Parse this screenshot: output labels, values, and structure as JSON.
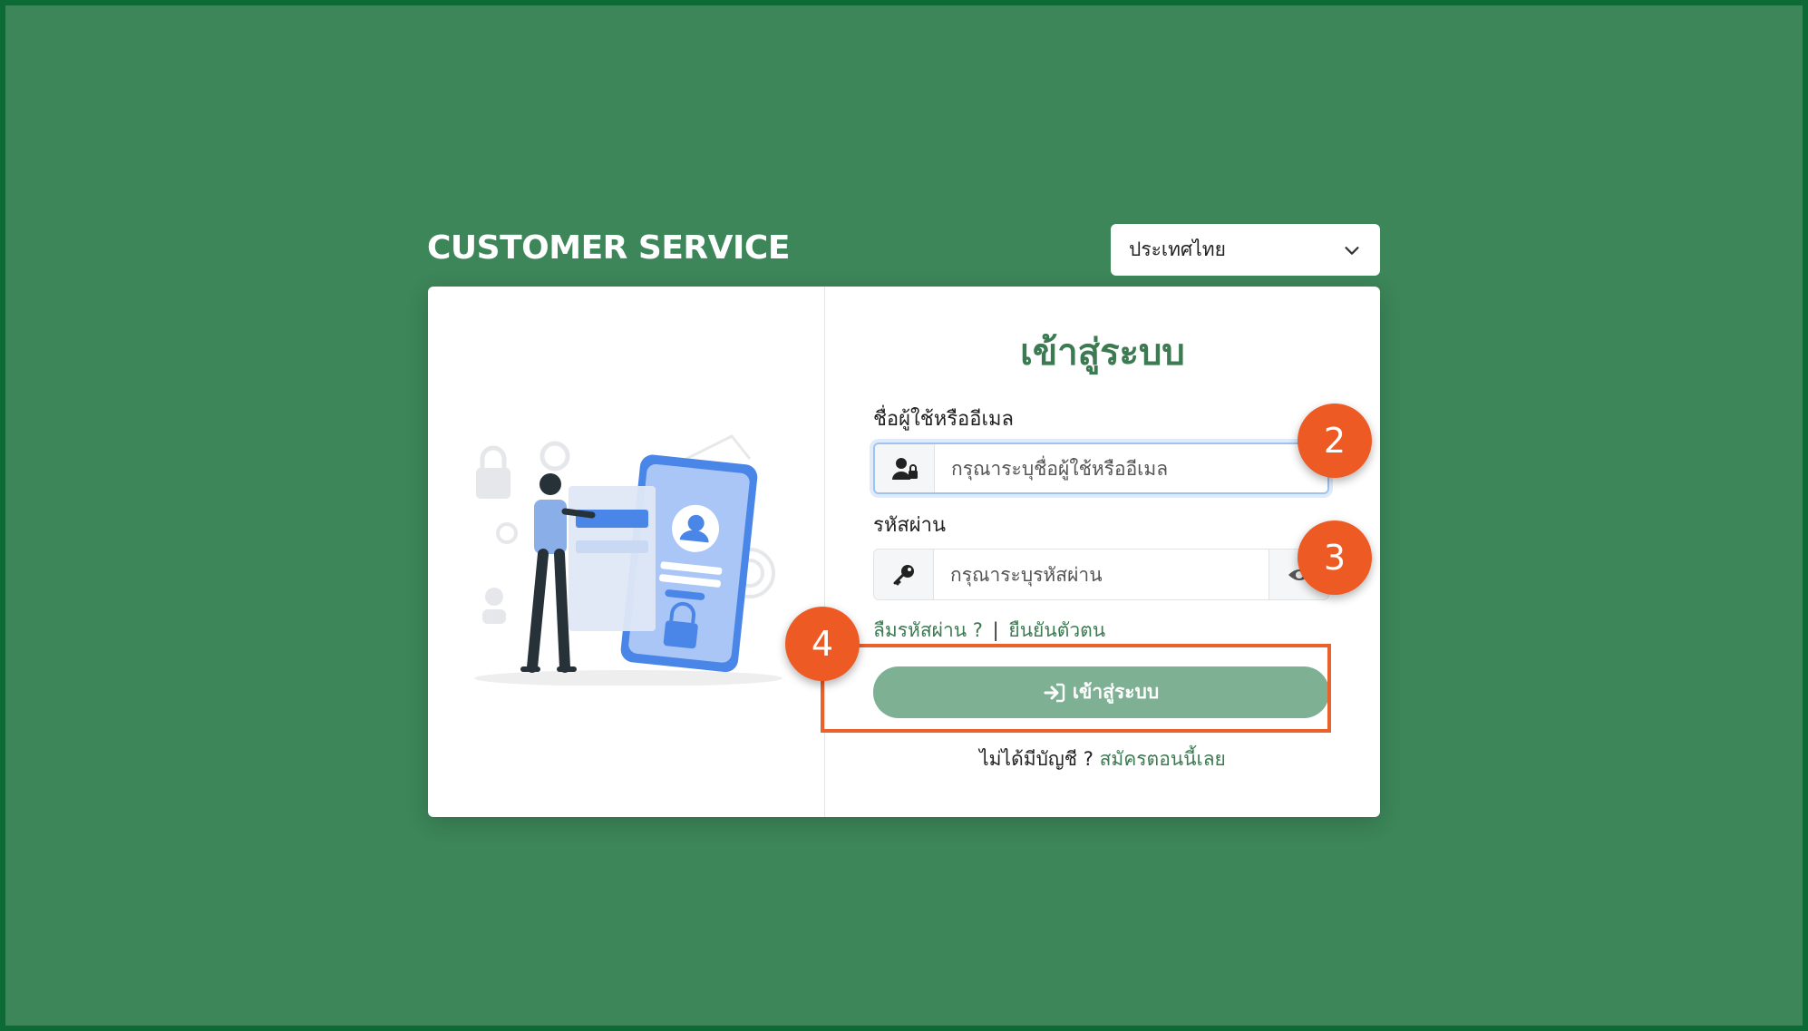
{
  "header": {
    "brand": "CUSTOMER SERVICE",
    "country_select": {
      "selected": "ประเทศไทย",
      "icon": "chevron-down-icon"
    }
  },
  "login": {
    "title": "เข้าสู่ระบบ",
    "username": {
      "label": "ชื่อผู้ใช้หรืออีเมล",
      "placeholder": "กรุณาระบุชื่อผู้ใช้หรืออีเมล",
      "value": "",
      "icon": "user-lock-icon"
    },
    "password": {
      "label": "รหัสผ่าน",
      "placeholder": "กรุณาระบุรหัสผ่าน",
      "value": "",
      "icon": "key-icon",
      "toggle_icon": "eye-icon"
    },
    "forgot_password": "ลืมรหัสผ่าน ?",
    "separator": "|",
    "verify_identity": "ยืนยันตัวตน",
    "submit_label": "เข้าสู่ระบบ",
    "submit_icon": "sign-in-icon",
    "no_account_text": "ไม่ได้มีบัญชี ?",
    "register_link": "สมัครตอนนี้เลย"
  },
  "annotations": {
    "marker_2": "2",
    "marker_3": "3",
    "marker_4": "4",
    "marker_color": "#ee5a24"
  },
  "colors": {
    "background": "#3c8659",
    "brand_green": "#3c7a52",
    "button_green": "#7eb193"
  }
}
